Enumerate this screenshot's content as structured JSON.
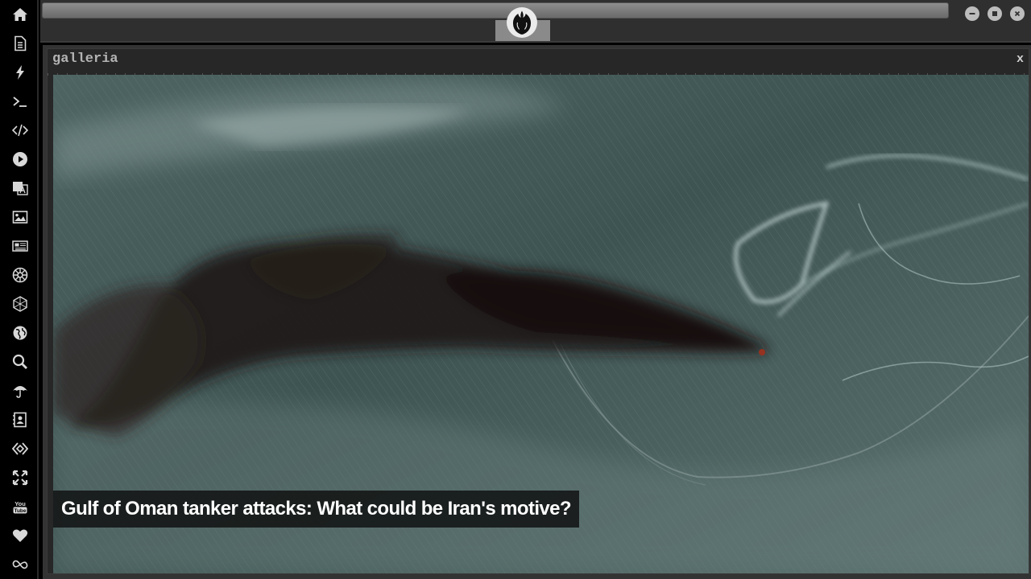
{
  "window": {
    "title": "galleria",
    "close_label": "x"
  },
  "gallery": {
    "caption": "Gulf of Oman tanker attacks: What could be Iran's motive?",
    "image_alt": "Satellite image of smoke plume over sea"
  },
  "sidebar": {
    "items": [
      {
        "icon": "home-icon"
      },
      {
        "icon": "document-icon"
      },
      {
        "icon": "lightning-icon"
      },
      {
        "icon": "terminal-icon"
      },
      {
        "icon": "code-icon"
      },
      {
        "icon": "play-icon"
      },
      {
        "icon": "translate-icon"
      },
      {
        "icon": "image-icon"
      },
      {
        "icon": "newspaper-icon"
      },
      {
        "icon": "empire-icon"
      },
      {
        "icon": "cube-icon"
      },
      {
        "icon": "globe-icon"
      },
      {
        "icon": "search-icon"
      },
      {
        "icon": "umbrella-icon"
      },
      {
        "icon": "contacts-icon"
      },
      {
        "icon": "diamond-code-icon"
      },
      {
        "icon": "expand-icon"
      },
      {
        "icon": "youtube-icon"
      },
      {
        "icon": "heart-icon"
      },
      {
        "icon": "infinity-icon"
      }
    ]
  },
  "colors": {
    "sidebar_bg": "#000000",
    "topbar_bg": "#2f2f2f",
    "window_bg": "#272727",
    "caption_bg": "#121414"
  }
}
